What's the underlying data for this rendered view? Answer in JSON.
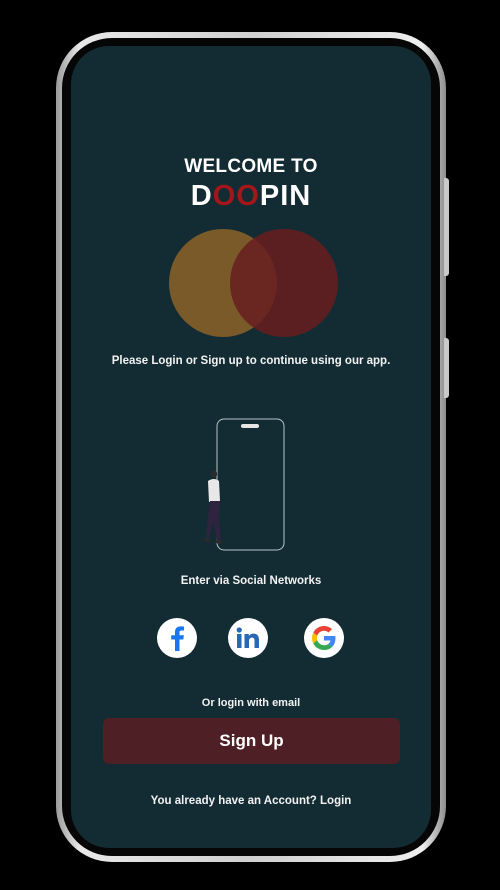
{
  "header": {
    "welcome": "WELCOME TO",
    "brand": {
      "part1": "D",
      "part2": "OO",
      "part3": "PIN",
      "accent_color": "#a4161a"
    }
  },
  "tagline": "Please Login or Sign up to continue using our app.",
  "illustration": {
    "icons": [
      "phone-outline-icon",
      "person-walking-icon"
    ]
  },
  "social": {
    "title": "Enter via Social Networks",
    "buttons": [
      {
        "network": "Facebook",
        "icon": "facebook-icon",
        "color": "#1877f2"
      },
      {
        "network": "LinkedIn",
        "icon": "linkedin-icon",
        "color": "#2867b2"
      },
      {
        "network": "Google",
        "icon": "google-icon"
      }
    ]
  },
  "email": {
    "label": "Or login with email",
    "signup_button": "Sign Up",
    "signup_color": "#4e1f24"
  },
  "footer": {
    "question": "You already have an Account? ",
    "login_link": "Login"
  },
  "colors": {
    "screen_background": "#132c33",
    "circle_left": "#7b5a2a",
    "circle_right": "#681d1f"
  }
}
